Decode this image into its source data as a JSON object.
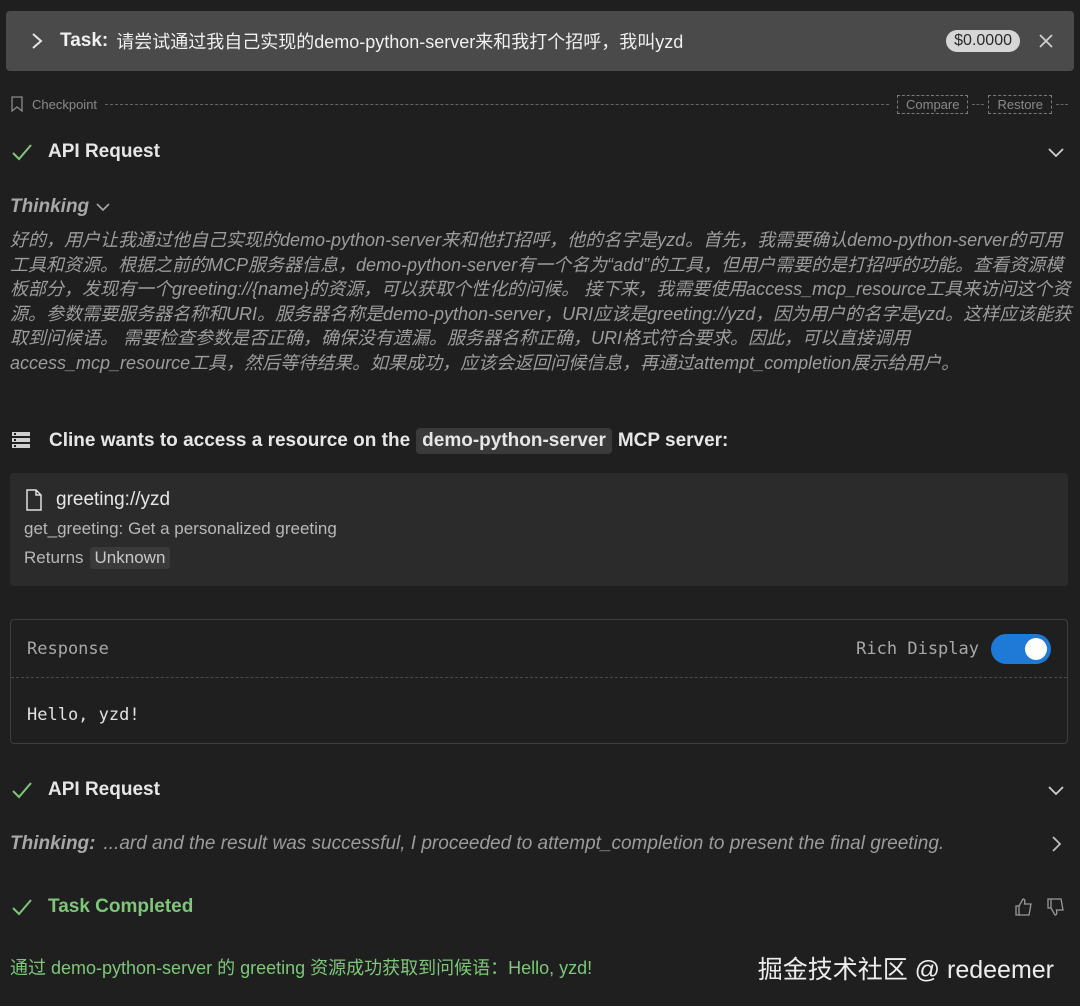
{
  "task": {
    "label": "Task:",
    "text": "请尝试通过我自己实现的demo-python-server来和我打个招呼，我叫yzd",
    "cost": "$0.0000"
  },
  "checkpoint": {
    "label": "Checkpoint",
    "compare": "Compare",
    "restore": "Restore"
  },
  "api_request_1": {
    "title": "API Request"
  },
  "thinking": {
    "label": "Thinking",
    "text": "好的，用户让我通过他自己实现的demo-python-server来和他打招呼，他的名字是yzd。首先，我需要确认demo-python-server的可用工具和资源。根据之前的MCP服务器信息，demo-python-server有一个名为“add”的工具，但用户需要的是打招呼的功能。查看资源模板部分，发现有一个greeting://{name}的资源，可以获取个性化的问候。 接下来，我需要使用access_mcp_resource工具来访问这个资源。参数需要服务器名称和URI。服务器名称是demo-python-server，URI应该是greeting://yzd，因为用户的名字是yzd。这样应该能获取到问候语。 需要检查参数是否正确，确保没有遗漏。服务器名称正确，URI格式符合要求。因此，可以直接调用access_mcp_resource工具，然后等待结果。如果成功，应该会返回问候信息，再通过attempt_completion展示给用户。"
  },
  "mcp": {
    "prefix": "Cline wants to access a resource on the",
    "server": "demo-python-server",
    "suffix": "MCP server:"
  },
  "resource": {
    "uri": "greeting://yzd",
    "description": "get_greeting: Get a personalized greeting",
    "returns_label": "Returns",
    "returns_value": "Unknown"
  },
  "response": {
    "label": "Response",
    "rich_display_label": "Rich Display",
    "rich_display_on": true,
    "body": "Hello, yzd!"
  },
  "api_request_2": {
    "title": "API Request"
  },
  "thinking_2": {
    "label": "Thinking:",
    "text": "...ard and the result was successful, I proceeded to attempt_completion to present the final greeting."
  },
  "task_completed": {
    "title": "Task Completed",
    "text": "通过 demo-python-server 的 greeting 资源成功获取到问候语：Hello, yzd!"
  },
  "watermark": "掘金技术社区 @ redeemer",
  "colors": {
    "background": "#1f1f1f",
    "header": "#4a4a4a",
    "success": "#7ec67a",
    "toggle": "#1f7ad6"
  }
}
